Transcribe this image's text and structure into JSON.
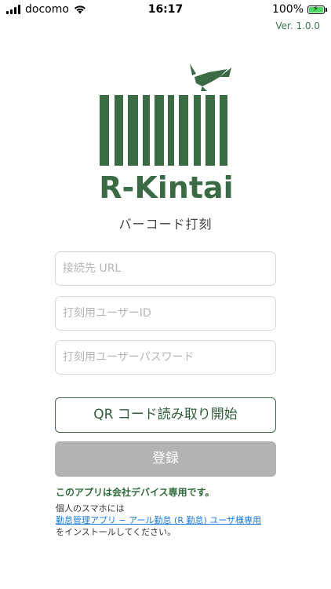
{
  "status_bar": {
    "carrier": "docomo",
    "time": "16:17",
    "battery": "100%"
  },
  "version": "Ver. 1.0.0",
  "app": {
    "logo_text": "R-Kintai",
    "subtitle": "バーコード打刻"
  },
  "form": {
    "url_placeholder": "接続先 URL",
    "user_id_placeholder": "打刻用ユーザーID",
    "password_placeholder": "打刻用ユーザーパスワード"
  },
  "buttons": {
    "qr": "QR コード読み取り開始",
    "register": "登録"
  },
  "notice": {
    "title": "このアプリは会社デバイス専用です。",
    "line1": "個人のスマホには",
    "link": "勤怠管理アプリ − アール勤怠 (R 勤怠) ユーザ様専用",
    "line3": "をインストールしてください。"
  },
  "colors": {
    "brand_green": "#3b6b45",
    "accent": "#3a7a4c",
    "link": "#1a7ad9",
    "disabled_button": "#b3b3b3"
  },
  "icons": [
    "signal-icon",
    "wifi-icon",
    "battery-icon",
    "whale-icon"
  ]
}
